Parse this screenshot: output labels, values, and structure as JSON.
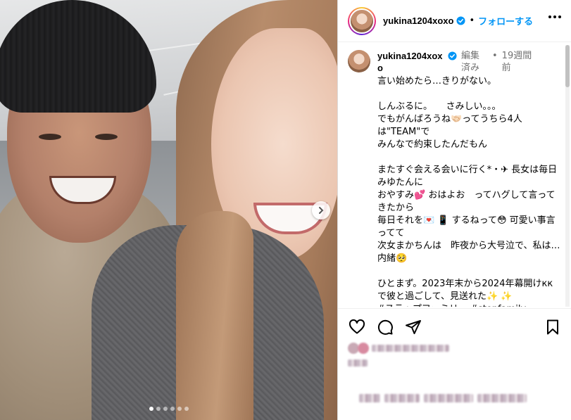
{
  "post": {
    "username": "yukina1204xoxo",
    "header_separator": "•",
    "follow_label": "フォローする",
    "edited_label": "編集済み",
    "time_separator": "•",
    "time_ago": "19週間前",
    "caption": "言い始めたら…きりがない。\n\nしんぶるに。　　さみしい。。。\nでもがんばろうね🤝🏻ってうちら4人は\"TEAM\"で\nみんなで約束したんだもん\n\nまたすぐ会える会いに行く*・✈ 長女は毎日みゆたんに\nおやすみ💕 おはよお　ってハグして言ってきたから\n毎日それを💌 📱 するねって😳 可愛い事言ってて\n次女まかちんは　昨夜から大号泣で、私は…内緒🥺\n\nひとまず。2023年末から2024年幕開けккで彼と過ごして、見送れた✨ ✨\n#ステップファミリー #stepfamily"
  },
  "media": {
    "dots_total": 6,
    "active_dot": 0
  },
  "icons": {
    "verified": "verified-badge-icon",
    "next": "chevron-right-icon",
    "like": "heart-icon",
    "comment": "comment-icon",
    "share": "paper-plane-icon",
    "save": "bookmark-icon",
    "more": "more-dots-icon"
  },
  "colors": {
    "accent": "#0095f6",
    "meta_text": "#737373",
    "border": "#dbdbdb"
  }
}
